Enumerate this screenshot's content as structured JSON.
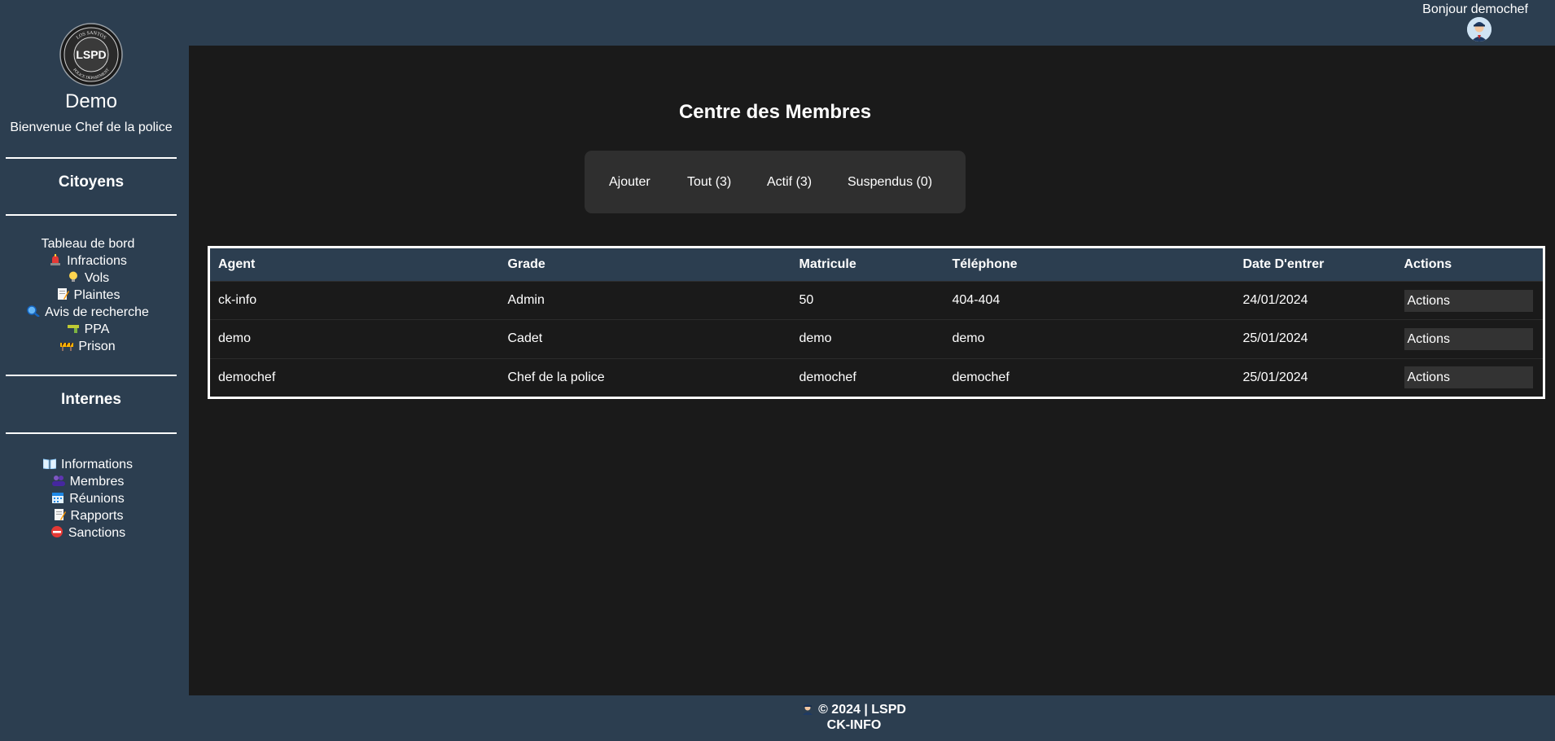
{
  "sidebar": {
    "logo": {
      "top_text": "LOS SANTOS",
      "center_text": "LSPD",
      "bottom_text": "POLICE DEPARTMENT"
    },
    "site_name": "Demo",
    "welcome": "Bienvenue Chef de la police",
    "sections": [
      {
        "title": "Citoyens",
        "items": [
          {
            "label": "Tableau de bord",
            "icon": "none"
          },
          {
            "label": "Infractions",
            "icon": "siren-icon"
          },
          {
            "label": "Vols",
            "icon": "lightbulb-icon"
          },
          {
            "label": "Plaintes",
            "icon": "memo-icon"
          },
          {
            "label": "Avis de recherche",
            "icon": "magnifier-icon"
          },
          {
            "label": "PPA",
            "icon": "gun-icon"
          },
          {
            "label": "Prison",
            "icon": "barrier-icon"
          }
        ]
      },
      {
        "title": "Internes",
        "items": [
          {
            "label": "Informations",
            "icon": "book-icon"
          },
          {
            "label": "Membres",
            "icon": "people-icon"
          },
          {
            "label": "Réunions",
            "icon": "calendar-icon"
          },
          {
            "label": "Rapports",
            "icon": "memo-icon"
          },
          {
            "label": "Sanctions",
            "icon": "no-entry-icon"
          }
        ]
      }
    ]
  },
  "topbar": {
    "greeting": "Bonjour demochef",
    "avatar_icon": "police-officer-avatar-icon"
  },
  "main": {
    "title": "Centre des Membres",
    "filters": [
      {
        "label": "Ajouter"
      },
      {
        "label": "Tout (3)"
      },
      {
        "label": "Actif (3)"
      },
      {
        "label": "Suspendus (0)"
      }
    ],
    "table": {
      "headers": [
        "Agent",
        "Grade",
        "Matricule",
        "Téléphone",
        "Date D'entrer",
        "Actions"
      ],
      "rows": [
        {
          "agent": "ck-info",
          "grade": "Admin",
          "matricule": "50",
          "telephone": "404-404",
          "date": "24/01/2024",
          "action": "Actions"
        },
        {
          "agent": "demo",
          "grade": "Cadet",
          "matricule": "demo",
          "telephone": "demo",
          "date": "25/01/2024",
          "action": "Actions"
        },
        {
          "agent": "demochef",
          "grade": "Chef de la police",
          "matricule": "demochef",
          "telephone": "demochef",
          "date": "25/01/2024",
          "action": "Actions"
        }
      ]
    }
  },
  "footer": {
    "icon": "police-officer-icon",
    "line1": "© 2024 | LSPD",
    "line2": "CK-INFO"
  },
  "colors": {
    "panel": "#2c3e50",
    "content_bg": "#1a1a1a",
    "filter_bg": "#2f2f2f",
    "button_bg": "#333333",
    "text": "#ffffff"
  }
}
